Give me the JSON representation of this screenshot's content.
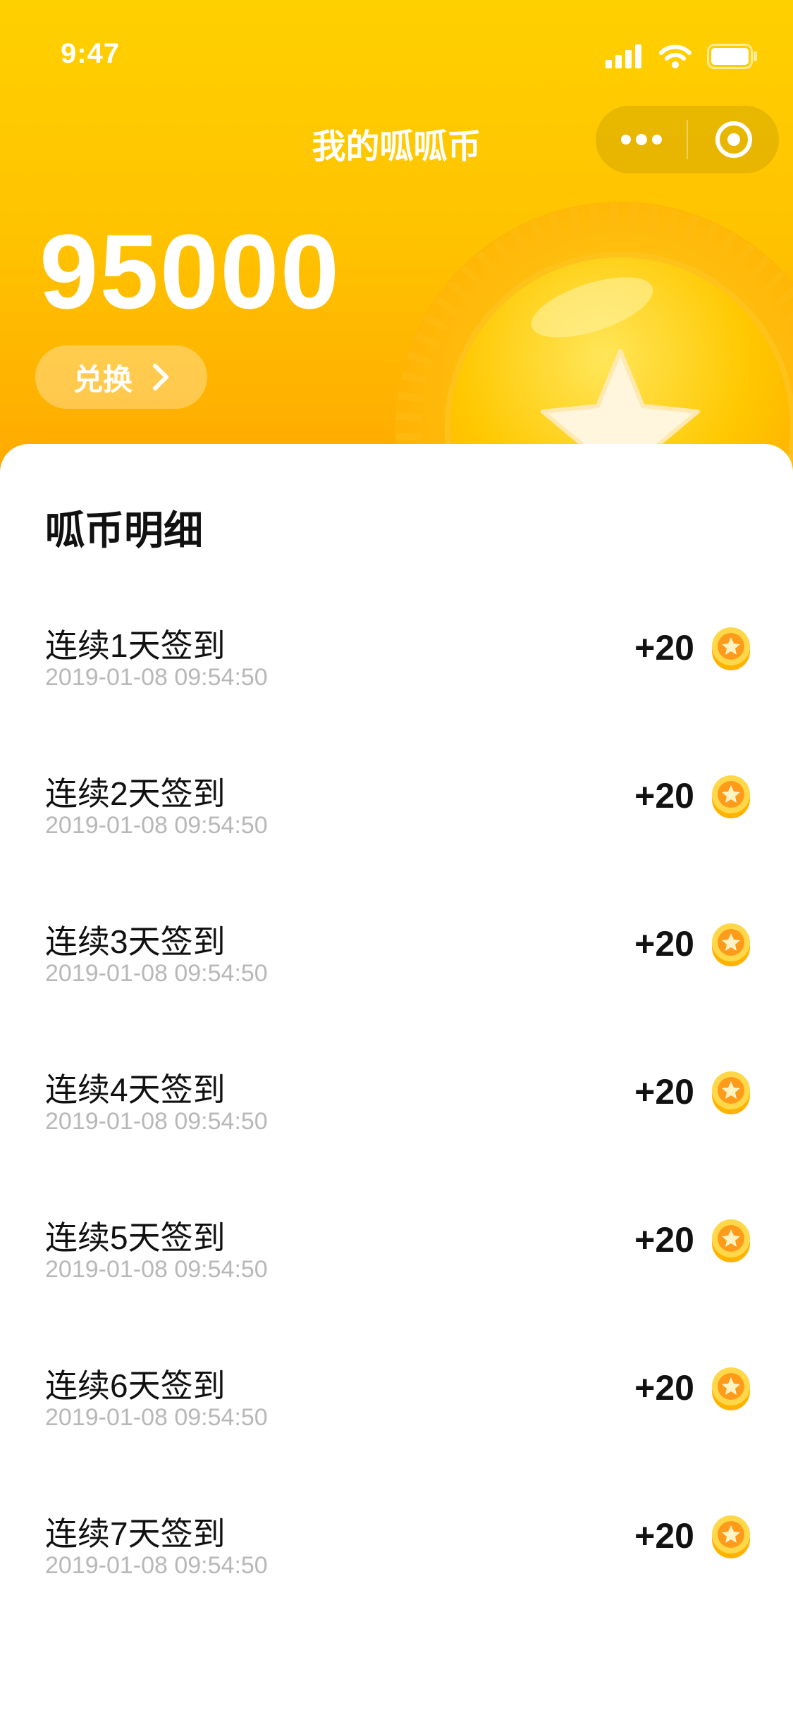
{
  "status_bar": {
    "time": "9:47"
  },
  "header": {
    "title": "我的呱呱币"
  },
  "balance": {
    "value": "95000"
  },
  "exchange": {
    "label": "兑换"
  },
  "section": {
    "title": "呱币明细"
  },
  "records": [
    {
      "title": "连续1天签到",
      "time": "2019-01-08 09:54:50",
      "amount": "+20"
    },
    {
      "title": "连续2天签到",
      "time": "2019-01-08 09:54:50",
      "amount": "+20"
    },
    {
      "title": "连续3天签到",
      "time": "2019-01-08 09:54:50",
      "amount": "+20"
    },
    {
      "title": "连续4天签到",
      "time": "2019-01-08 09:54:50",
      "amount": "+20"
    },
    {
      "title": "连续5天签到",
      "time": "2019-01-08 09:54:50",
      "amount": "+20"
    },
    {
      "title": "连续6天签到",
      "time": "2019-01-08 09:54:50",
      "amount": "+20"
    },
    {
      "title": "连续7天签到",
      "time": "2019-01-08 09:54:50",
      "amount": "+20"
    }
  ],
  "icons": {
    "signal": "signal-icon",
    "wifi": "wifi-icon",
    "battery": "battery-icon",
    "more": "more-dots-icon",
    "close": "target-close-icon",
    "chevron": "chevron-right-icon",
    "coin": "coin-star-icon"
  },
  "colors": {
    "header_top": "#ffd000",
    "header_bottom": "#ffa800",
    "text_primary": "#111111",
    "text_secondary": "#b8b8b8"
  }
}
